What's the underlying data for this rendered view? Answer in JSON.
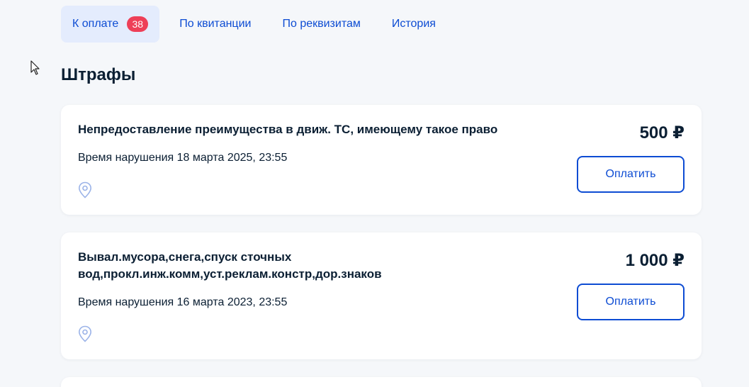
{
  "tabs": [
    {
      "label": "К оплате",
      "badge": "38",
      "active": true
    },
    {
      "label": "По квитанции"
    },
    {
      "label": "По реквизитам"
    },
    {
      "label": "История"
    }
  ],
  "section": {
    "title": "Штрафы"
  },
  "fines": [
    {
      "title": "Непредоставление преимущества в движ. ТС, имеющему такое право",
      "time": "Время нарушения 18 марта 2025, 23:55",
      "amount": "500 ₽",
      "pay_label": "Оплатить"
    },
    {
      "title": "Вывал.мусора,снега,спуск сточных вод,прокл.инж.комм,уст.реклам.констр,дор.знаков",
      "time": "Время нарушения 16 марта 2023, 23:55",
      "amount": "1 000 ₽",
      "pay_label": "Оплатить"
    }
  ],
  "colors": {
    "accent": "#0d4cd3",
    "active_tab_bg": "#e4ecfd",
    "badge_bg": "#ee3f58",
    "page_bg": "#f5f7fa",
    "text": "#0b1f33"
  },
  "icons": {
    "location": "location-pin-icon",
    "cursor": "mouse-cursor-icon"
  }
}
